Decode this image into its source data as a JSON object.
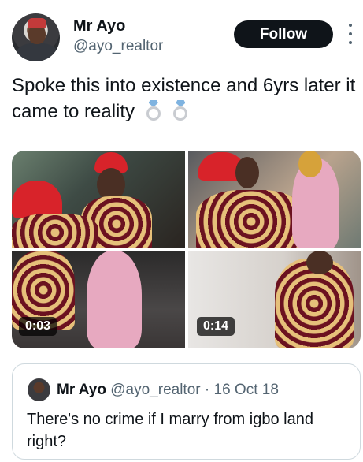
{
  "tweet": {
    "author_name": "Mr Ayo",
    "author_handle": "@ayo_realtor",
    "follow_label": "Follow",
    "text": "Spoke this into existence and 6yrs later it came to reality",
    "emoji": [
      "ring-icon",
      "ring-icon"
    ]
  },
  "media": {
    "videos": [
      {
        "duration": "0:03"
      },
      {
        "duration": "0:14"
      }
    ]
  },
  "quoted": {
    "author_name": "Mr Ayo",
    "author_handle": "@ayo_realtor",
    "separator": "·",
    "date": "16 Oct 18",
    "text": "There's no crime if I marry from igbo land right?"
  },
  "colors": {
    "follow_bg": "#0f1419",
    "secondary_text": "#536471",
    "border": "#cfd9de"
  }
}
